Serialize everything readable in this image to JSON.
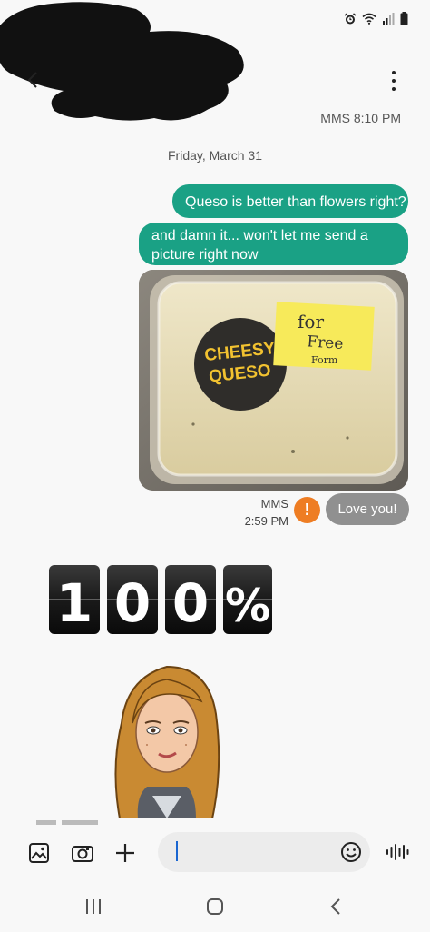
{
  "header": {
    "meta": "MMS 8:10 PM"
  },
  "conversation": {
    "date_separator": "Friday, March 31",
    "sent_messages": [
      {
        "text": "Queso is better than flowers right?"
      },
      {
        "text": "and damn it...  won't let me send a picture right  now"
      }
    ],
    "photo": {
      "label_line1": "CHEESY",
      "label_line2": "QUESO",
      "note_line1": "for",
      "note_line2": "Free",
      "note_line3": "Form"
    },
    "failed_message": {
      "meta_line1": "MMS",
      "meta_line2": "2:59 PM",
      "error_symbol": "!",
      "text": "Love you!"
    },
    "sticker": {
      "digits": [
        "1",
        "0",
        "0",
        "%"
      ]
    }
  },
  "compose": {
    "placeholder": ""
  },
  "colors": {
    "sent_bubble": "#1aa185",
    "failed_bubble": "#909090",
    "error_badge": "#ee7d23",
    "caret": "#1a66d1"
  },
  "icons": {
    "status": [
      "alarm-icon",
      "wifi-icon",
      "signal-icon",
      "battery-icon"
    ],
    "compose": [
      "gallery-icon",
      "camera-icon",
      "plus-icon",
      "emoji-icon",
      "voice-icon"
    ],
    "nav": [
      "recents-icon",
      "home-icon",
      "back-icon"
    ]
  }
}
